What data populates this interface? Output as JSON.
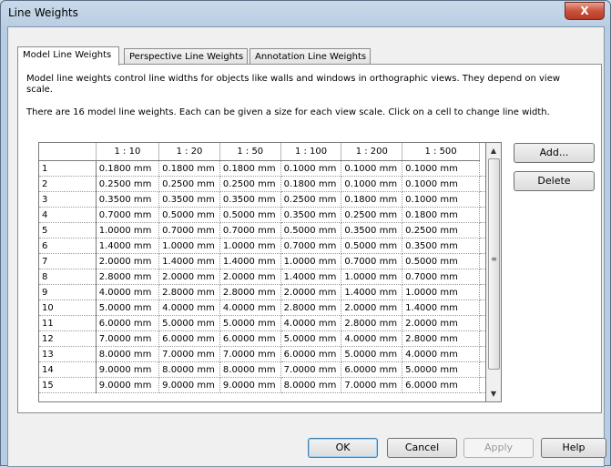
{
  "window": {
    "title": "Line Weights",
    "close_glyph": "X"
  },
  "tabs": [
    {
      "label": "Model Line Weights",
      "active": true
    },
    {
      "label": "Perspective Line Weights",
      "active": false
    },
    {
      "label": "Annotation Line Weights",
      "active": false
    }
  ],
  "description": {
    "line1": "Model line weights control line widths for objects like walls and windows in orthographic views. They depend on view scale.",
    "line2": "There are 16 model line weights. Each can be given a size for each view scale. Click on a cell to change line width."
  },
  "table": {
    "columns": [
      "1 : 10",
      "1 : 20",
      "1 : 50",
      "1 : 100",
      "1 : 200",
      "1 : 500"
    ],
    "rows": [
      {
        "label": "1",
        "cells": [
          "0.1800 mm",
          "0.1800 mm",
          "0.1800 mm",
          "0.1000 mm",
          "0.1000 mm",
          "0.1000 mm"
        ]
      },
      {
        "label": "2",
        "cells": [
          "0.2500 mm",
          "0.2500 mm",
          "0.2500 mm",
          "0.1800 mm",
          "0.1000 mm",
          "0.1000 mm"
        ]
      },
      {
        "label": "3",
        "cells": [
          "0.3500 mm",
          "0.3500 mm",
          "0.3500 mm",
          "0.2500 mm",
          "0.1800 mm",
          "0.1000 mm"
        ]
      },
      {
        "label": "4",
        "cells": [
          "0.7000 mm",
          "0.5000 mm",
          "0.5000 mm",
          "0.3500 mm",
          "0.2500 mm",
          "0.1800 mm"
        ]
      },
      {
        "label": "5",
        "cells": [
          "1.0000 mm",
          "0.7000 mm",
          "0.7000 mm",
          "0.5000 mm",
          "0.3500 mm",
          "0.2500 mm"
        ]
      },
      {
        "label": "6",
        "cells": [
          "1.4000 mm",
          "1.0000 mm",
          "1.0000 mm",
          "0.7000 mm",
          "0.5000 mm",
          "0.3500 mm"
        ]
      },
      {
        "label": "7",
        "cells": [
          "2.0000 mm",
          "1.4000 mm",
          "1.4000 mm",
          "1.0000 mm",
          "0.7000 mm",
          "0.5000 mm"
        ]
      },
      {
        "label": "8",
        "cells": [
          "2.8000 mm",
          "2.0000 mm",
          "2.0000 mm",
          "1.4000 mm",
          "1.0000 mm",
          "0.7000 mm"
        ]
      },
      {
        "label": "9",
        "cells": [
          "4.0000 mm",
          "2.8000 mm",
          "2.8000 mm",
          "2.0000 mm",
          "1.4000 mm",
          "1.0000 mm"
        ]
      },
      {
        "label": "10",
        "cells": [
          "5.0000 mm",
          "4.0000 mm",
          "4.0000 mm",
          "2.8000 mm",
          "2.0000 mm",
          "1.4000 mm"
        ]
      },
      {
        "label": "11",
        "cells": [
          "6.0000 mm",
          "5.0000 mm",
          "5.0000 mm",
          "4.0000 mm",
          "2.8000 mm",
          "2.0000 mm"
        ]
      },
      {
        "label": "12",
        "cells": [
          "7.0000 mm",
          "6.0000 mm",
          "6.0000 mm",
          "5.0000 mm",
          "4.0000 mm",
          "2.8000 mm"
        ]
      },
      {
        "label": "13",
        "cells": [
          "8.0000 mm",
          "7.0000 mm",
          "7.0000 mm",
          "6.0000 mm",
          "5.0000 mm",
          "4.0000 mm"
        ]
      },
      {
        "label": "14",
        "cells": [
          "9.0000 mm",
          "8.0000 mm",
          "8.0000 mm",
          "7.0000 mm",
          "6.0000 mm",
          "5.0000 mm"
        ]
      },
      {
        "label": "15",
        "cells": [
          "9.0000 mm",
          "9.0000 mm",
          "9.0000 mm",
          "8.0000 mm",
          "7.0000 mm",
          "6.0000 mm"
        ]
      }
    ]
  },
  "side_buttons": {
    "add": "Add...",
    "delete": "Delete"
  },
  "footer_buttons": {
    "ok": "OK",
    "cancel": "Cancel",
    "apply": "Apply",
    "help": "Help"
  },
  "colors": {
    "title_bar": "#b9cde2",
    "close_button": "#c9533d",
    "grid_border": "#7a7a7a"
  }
}
